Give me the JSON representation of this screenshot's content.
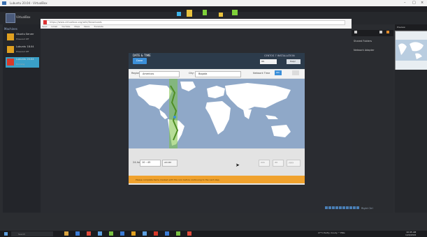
{
  "window": {
    "title": "Lubuntu 20.04 - VirtualBox",
    "controls": [
      "–",
      "□",
      "×"
    ]
  },
  "host_menu": [
    "File",
    "Machine",
    "Help"
  ],
  "app": {
    "name": "VirtualBox"
  },
  "toolbar_icon_colors": [
    "#3db3e8",
    "#e8c23d",
    "#7ed13a",
    "#e8c23d",
    "#7ed13a"
  ],
  "vm_list": {
    "header": "Machines",
    "items": [
      {
        "name": "Ubuntu Server",
        "status": "Powered Off",
        "icon_color": "#e0a020",
        "selected": false
      },
      {
        "name": "Lubuntu 18.04",
        "status": "Powered Off",
        "icon_color": "#e0a020",
        "selected": false
      },
      {
        "name": "Lubuntu 20.04",
        "status": "Running",
        "icon_color": "#d83a2a",
        "selected": true
      }
    ]
  },
  "browser": {
    "url": "https://www.virtualbox.org/wiki/Downloads",
    "bookmarks": [
      "Apps",
      "Gmail",
      "YouTube",
      "Maps",
      "News",
      "Translate"
    ]
  },
  "right_panel": {
    "rows": [
      "Shared Folders",
      "Network Adapter"
    ],
    "preview_label": "Preview"
  },
  "dialog": {
    "title": "DATE & TIME",
    "done_label": "Done",
    "subtitle": "CENTOS 7 INSTALLATION",
    "keyboard": "us",
    "help_label": "Help!",
    "region_label": "Region:",
    "region_value": "Americas",
    "city_label": "City:",
    "city_value": "Bogota",
    "ntp_label": "Network Time",
    "ntp_value": "ON",
    "time_format_label": "24-hour",
    "time_value": "10 : 45",
    "ampm_value": "AM  PM",
    "date_parts": [
      "mm",
      "dd",
      "yyyy"
    ],
    "warning": "Please complete items marked with this icon before continuing to the next step."
  },
  "cursor": "➤",
  "vm_status_icon_count": 10,
  "vm_status_text": "Right Ctrl",
  "taskbar": {
    "search_placeholder": "Search",
    "icon_colors": [
      "#d9a441",
      "#3a7bd5",
      "#e04a3a",
      "#5ea0e0",
      "#7ac142",
      "#3a7bd5",
      "#e0a020",
      "#5ea0e0",
      "#d83a2a",
      "#3a7bd5",
      "#7ac142",
      "#e04a3a"
    ],
    "tray_text": "27°C  Partly cloudy  ^  ENG",
    "time": "10:45 AM",
    "date": "1/20/2022"
  }
}
